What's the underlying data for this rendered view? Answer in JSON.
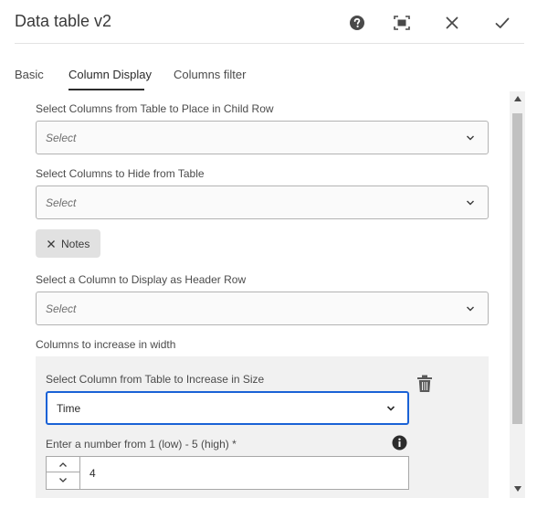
{
  "dialog": {
    "title": "Data table v2",
    "actions": {
      "help_icon": "help-icon",
      "fullscreen_icon": "fullscreen-icon",
      "close_icon": "close-icon",
      "confirm_icon": "check-icon"
    }
  },
  "tabs": [
    {
      "label": "Basic",
      "active": false
    },
    {
      "label": "Column Display",
      "active": true
    },
    {
      "label": "Columns filter",
      "active": false
    }
  ],
  "fields": {
    "child_row": {
      "label": "Select Columns from Table to Place in Child Row",
      "placeholder": "Select"
    },
    "hide": {
      "label": "Select Columns to Hide from Table",
      "placeholder": "Select",
      "tags": [
        "Notes"
      ]
    },
    "header_row": {
      "label": "Select a Column to Display as Header Row",
      "placeholder": "Select"
    },
    "increase_width": {
      "label": "Columns to increase in width",
      "item": {
        "column_label": "Select Column from Table to Increase in Size",
        "column_value": "Time",
        "size_label": "Enter a number from 1 (low) - 5 (high) *",
        "size_value": "4"
      }
    }
  },
  "colors": {
    "focus_border": "#1a62d6",
    "tag_bg": "#e1e1e1",
    "panel_bg": "#f1f1f1"
  }
}
